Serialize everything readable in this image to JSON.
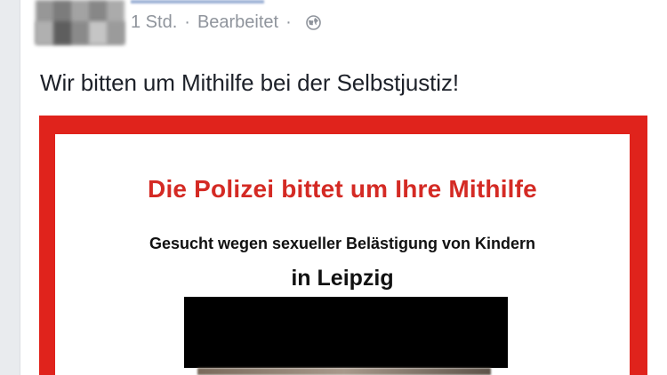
{
  "post": {
    "meta": {
      "time": "1 Std.",
      "separator": "·",
      "edited": "Bearbeitet",
      "separator2": "·",
      "audience_icon": "globe-icon"
    },
    "text": "Wir bitten um Mithilfe bei der Selbstjustiz!"
  },
  "poster": {
    "title": "Die Polizei bittet um Ihre Mithilfe",
    "subtitle": "Gesucht wegen sexueller Belästigung von Kindern",
    "city": "in Leipzig"
  },
  "colors": {
    "poster_border": "#e0231c",
    "poster_title": "#d42a24",
    "meta_text": "#8f949c",
    "background": "#e9ebee"
  }
}
